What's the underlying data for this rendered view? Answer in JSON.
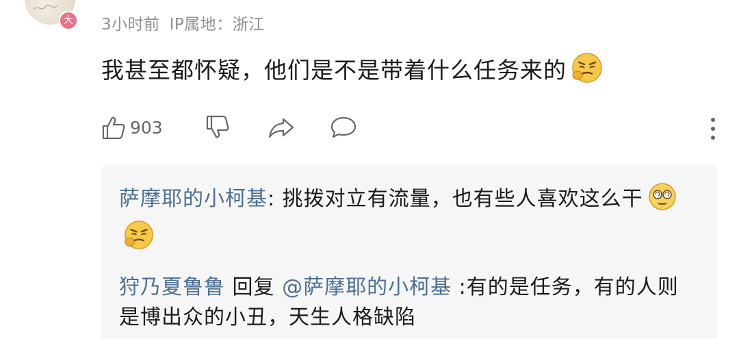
{
  "comment": {
    "avatar_badge": "大",
    "time": "3小时前",
    "ip_location": "IP属地：浙江",
    "text": "我甚至都怀疑，他们是不是带着什么任务来的",
    "emoji": "grimace-face-emoji"
  },
  "actions": {
    "like_count": "903",
    "like_icon": "thumbs-up-icon",
    "dislike_icon": "thumbs-down-icon",
    "share_icon": "share-icon",
    "reply_icon": "comment-bubble-icon",
    "more_icon": "more-vertical-icon"
  },
  "replies": [
    {
      "author": "萨摩耶的小柯基",
      "separator": ":",
      "text": " 挑拨对立有流量，也有些人喜欢这么干",
      "emojis": [
        "dizzy-face-emoji",
        "grimace-face-emoji"
      ]
    },
    {
      "author": "狩乃夏鲁鲁",
      "reply_word": " 回复 ",
      "mention": "@萨摩耶的小柯基",
      "separator": " :",
      "text": "有的是任务，有的人则是博出众的小丑，天生人格缺陷"
    }
  ],
  "colors": {
    "link_blue": "#4b6f95",
    "meta_gray": "#8f8f8f",
    "reply_bg": "#f6f6f6",
    "badge_pink": "#e9708d"
  }
}
